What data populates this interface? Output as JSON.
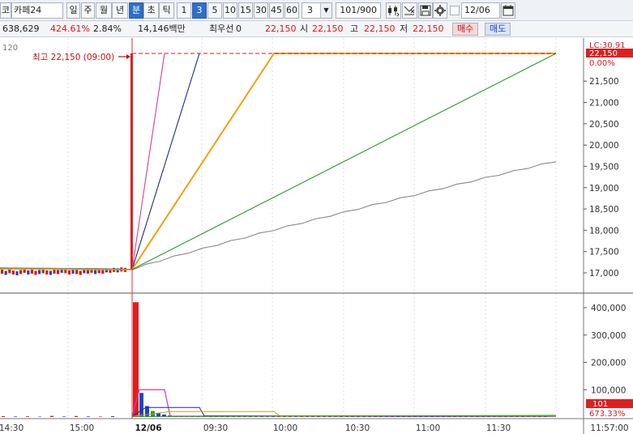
{
  "toolbar": {
    "market_prefix": "코",
    "stock_name": "카페24",
    "period_buttons": [
      "일",
      "주",
      "월",
      "년",
      "분",
      "초",
      "틱"
    ],
    "minute_buttons": [
      "1",
      "3",
      "5",
      "10",
      "15",
      "30",
      "45",
      "60"
    ],
    "interval_value": "3",
    "count_display": "101/900",
    "date_value": "12/06"
  },
  "info": {
    "volume": "638,629",
    "volume_rate": "424.61%",
    "turnover_rate": "2.84%",
    "amount": "14,146백만",
    "best_bid_label": "최우선",
    "best_bid_value": "0",
    "current": "22,150",
    "open_label": "시",
    "open": "22,150",
    "high_label": "고",
    "high": "22,150",
    "low_label": "저",
    "low": "22,150",
    "buy_label": "매수",
    "sell_label": "매도"
  },
  "chart_data": {
    "type": "candlestick",
    "price_scale_label": "120",
    "price_ticks": [
      "21,500",
      "21,000",
      "20,500",
      "20,000",
      "19,500",
      "19,000",
      "18,500",
      "18,000",
      "17,500",
      "17,000"
    ],
    "price_ylim": [
      16750,
      22300
    ],
    "current_price_tag": "22,150",
    "current_change_tag": "0.00%",
    "top_marker": "LC:30.91",
    "high_annotation": "최고 22,150 (09:00)",
    "high_value": 22150,
    "volume_ticks": [
      "400,000",
      "300,000",
      "200,000",
      "100,000"
    ],
    "volume_ylim": [
      0,
      450000
    ],
    "volume_tag": "101",
    "volume_change_tag": "673.33%",
    "x_ticks": [
      "14:30",
      "15:00",
      "12/06",
      "09:30",
      "10:00",
      "10:30",
      "11:00",
      "11:30",
      "11:57:00"
    ],
    "big_volume_bar": 420000,
    "moving_averages": [
      {
        "color": "#d23fa0",
        "start": 17080,
        "end": 22150
      },
      {
        "color": "#1b2c86",
        "start": 17080,
        "end": 22150
      },
      {
        "color": "#f0a010",
        "start": 17080,
        "end": 22150
      },
      {
        "color": "#2a9a2a",
        "start": 17080,
        "end": 22150
      },
      {
        "color": "#888888",
        "start": 17080,
        "end": 19620
      }
    ]
  }
}
